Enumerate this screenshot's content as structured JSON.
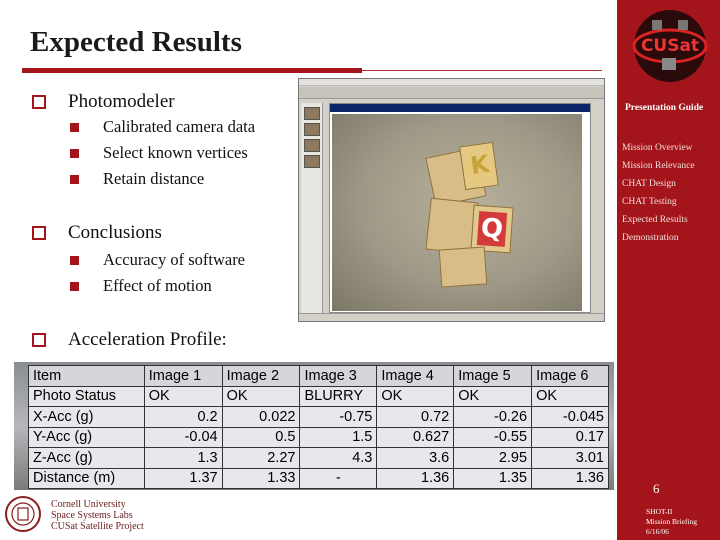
{
  "slide": {
    "title": "Expected Results"
  },
  "bullets": {
    "photomodeler": {
      "label": "Photomodeler",
      "items": [
        "Calibrated camera data",
        "Select known vertices",
        "Retain distance"
      ]
    },
    "conclusions": {
      "label": "Conclusions",
      "items": [
        "Accuracy of software",
        "Effect of motion"
      ]
    },
    "acceleration": {
      "label": "Acceleration Profile:"
    }
  },
  "screenshot": {
    "block_letters": [
      "K",
      "Q"
    ]
  },
  "table": {
    "headers": [
      "Item",
      "Image 1",
      "Image 2",
      "Image 3",
      "Image 4",
      "Image 5",
      "Image 6"
    ],
    "rows": [
      {
        "label": "Photo Status",
        "cells": [
          "OK",
          "OK",
          "BLURRY",
          "OK",
          "OK",
          "OK"
        ]
      },
      {
        "label": "X-Acc (g)",
        "cells": [
          "0.2",
          "0.022",
          "-0.75",
          "0.72",
          "-0.26",
          "-0.045"
        ]
      },
      {
        "label": "Y-Acc (g)",
        "cells": [
          "-0.04",
          "0.5",
          "1.5",
          "0.627",
          "-0.55",
          "0.17"
        ]
      },
      {
        "label": "Z-Acc (g)",
        "cells": [
          "1.3",
          "2.27",
          "4.3",
          "3.6",
          "2.95",
          "3.01"
        ]
      },
      {
        "label": "Distance (m)",
        "cells": [
          "1.37",
          "1.33",
          "-",
          "1.36",
          "1.35",
          "1.36"
        ]
      }
    ]
  },
  "sidebar": {
    "logo_text": "CUSat",
    "guide_title": "Presentation Guide",
    "nav": [
      "Mission Overview",
      "Mission Relevance",
      "CHAT Design",
      "CHAT Testing",
      "Expected Results",
      "Demonstration"
    ],
    "page_number": "6",
    "briefing": [
      "SHOT-II",
      "Mission Briefing",
      "6/16/06"
    ]
  },
  "footer": {
    "lines": [
      "Cornell University",
      "Space Systems Labs",
      "CUSat Satellite Project"
    ]
  },
  "colors": {
    "accent": "#a4151b",
    "sidebar_bg": "#a3151b"
  }
}
